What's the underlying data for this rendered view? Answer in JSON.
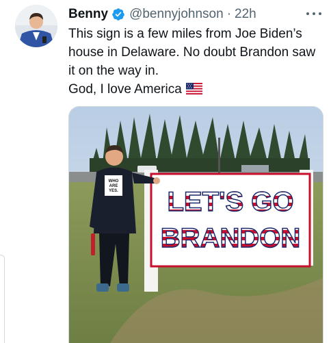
{
  "tweet": {
    "author_name": "Benny",
    "handle": "@bennyjohnson",
    "separator": "·",
    "timestamp": "22h",
    "text_lines": [
      "This sign is a few miles from Joe Biden’s",
      "house in Delaware. No doubt Brandon saw",
      "it on the way in.",
      "God, I love America"
    ],
    "icons": {
      "verified": "verified-badge-icon",
      "more": "more-options-icon",
      "flag": "us-flag-emoji"
    },
    "photo": {
      "sign_line_1": "LET'S GO",
      "sign_line_2": "BRANDON",
      "shirt_text": [
        "WHO",
        "ARE",
        "YES."
      ]
    }
  },
  "colors": {
    "verified_blue": "#1d9bf0",
    "muted_text": "#536471",
    "sign_red": "#c8102e",
    "sign_navy": "#1b2a6b"
  }
}
